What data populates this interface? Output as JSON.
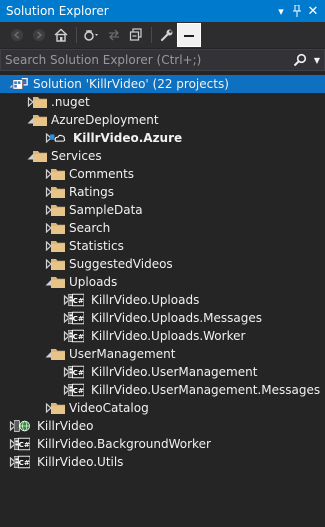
{
  "window": {
    "title": "Solution Explorer",
    "pin_glyph": "▾",
    "autohide_glyph": "⊥",
    "close_glyph": "✕"
  },
  "search": {
    "placeholder": "Search Solution Explorer (Ctrl+;)",
    "value": ""
  },
  "tree": [
    {
      "label": "Solution 'KillrVideo' (22 projects)",
      "depth": 0,
      "expand": "open",
      "icon": "solution-icon",
      "selected": true,
      "bold": false
    },
    {
      "label": ".nuget",
      "depth": 1,
      "expand": "closed",
      "icon": "folder-icon",
      "selected": false,
      "bold": false
    },
    {
      "label": "AzureDeployment",
      "depth": 1,
      "expand": "open",
      "icon": "folder-icon",
      "selected": false,
      "bold": false
    },
    {
      "label": "KillrVideo.Azure",
      "depth": 2,
      "expand": "closed",
      "icon": "cloud-project-icon",
      "selected": false,
      "bold": true
    },
    {
      "label": "Services",
      "depth": 1,
      "expand": "open",
      "icon": "folder-icon",
      "selected": false,
      "bold": false
    },
    {
      "label": "Comments",
      "depth": 2,
      "expand": "closed",
      "icon": "folder-icon",
      "selected": false,
      "bold": false
    },
    {
      "label": "Ratings",
      "depth": 2,
      "expand": "closed",
      "icon": "folder-icon",
      "selected": false,
      "bold": false
    },
    {
      "label": "SampleData",
      "depth": 2,
      "expand": "closed",
      "icon": "folder-icon",
      "selected": false,
      "bold": false
    },
    {
      "label": "Search",
      "depth": 2,
      "expand": "closed",
      "icon": "folder-icon",
      "selected": false,
      "bold": false
    },
    {
      "label": "Statistics",
      "depth": 2,
      "expand": "closed",
      "icon": "folder-icon",
      "selected": false,
      "bold": false
    },
    {
      "label": "SuggestedVideos",
      "depth": 2,
      "expand": "closed",
      "icon": "folder-icon",
      "selected": false,
      "bold": false
    },
    {
      "label": "Uploads",
      "depth": 2,
      "expand": "open",
      "icon": "folder-icon",
      "selected": false,
      "bold": false
    },
    {
      "label": "KillrVideo.Uploads",
      "depth": 3,
      "expand": "closed",
      "icon": "csharp-project-icon",
      "selected": false,
      "bold": false
    },
    {
      "label": "KillrVideo.Uploads.Messages",
      "depth": 3,
      "expand": "closed",
      "icon": "csharp-project-icon",
      "selected": false,
      "bold": false
    },
    {
      "label": "KillrVideo.Uploads.Worker",
      "depth": 3,
      "expand": "closed",
      "icon": "csharp-project-icon",
      "selected": false,
      "bold": false
    },
    {
      "label": "UserManagement",
      "depth": 2,
      "expand": "open",
      "icon": "folder-icon",
      "selected": false,
      "bold": false
    },
    {
      "label": "KillrVideo.UserManagement",
      "depth": 3,
      "expand": "closed",
      "icon": "csharp-project-icon",
      "selected": false,
      "bold": false
    },
    {
      "label": "KillrVideo.UserManagement.Messages",
      "depth": 3,
      "expand": "closed",
      "icon": "csharp-project-icon",
      "selected": false,
      "bold": false
    },
    {
      "label": "VideoCatalog",
      "depth": 2,
      "expand": "closed",
      "icon": "folder-icon",
      "selected": false,
      "bold": false
    },
    {
      "label": "KillrVideo",
      "depth": 0,
      "expand": "closed",
      "icon": "web-project-icon",
      "selected": false,
      "bold": false
    },
    {
      "label": "KillrVideo.BackgroundWorker",
      "depth": 0,
      "expand": "closed",
      "icon": "csharp-project-icon",
      "selected": false,
      "bold": false
    },
    {
      "label": "KillrVideo.Utils",
      "depth": 0,
      "expand": "closed",
      "icon": "csharp-project-icon",
      "selected": false,
      "bold": false
    }
  ],
  "colors": {
    "title_bar": "#007acc",
    "selected_row": "#0e70c0",
    "folder": "#dcb67a",
    "csharp": "#68217a",
    "web": "#3a9a3a",
    "background": "#252526"
  }
}
